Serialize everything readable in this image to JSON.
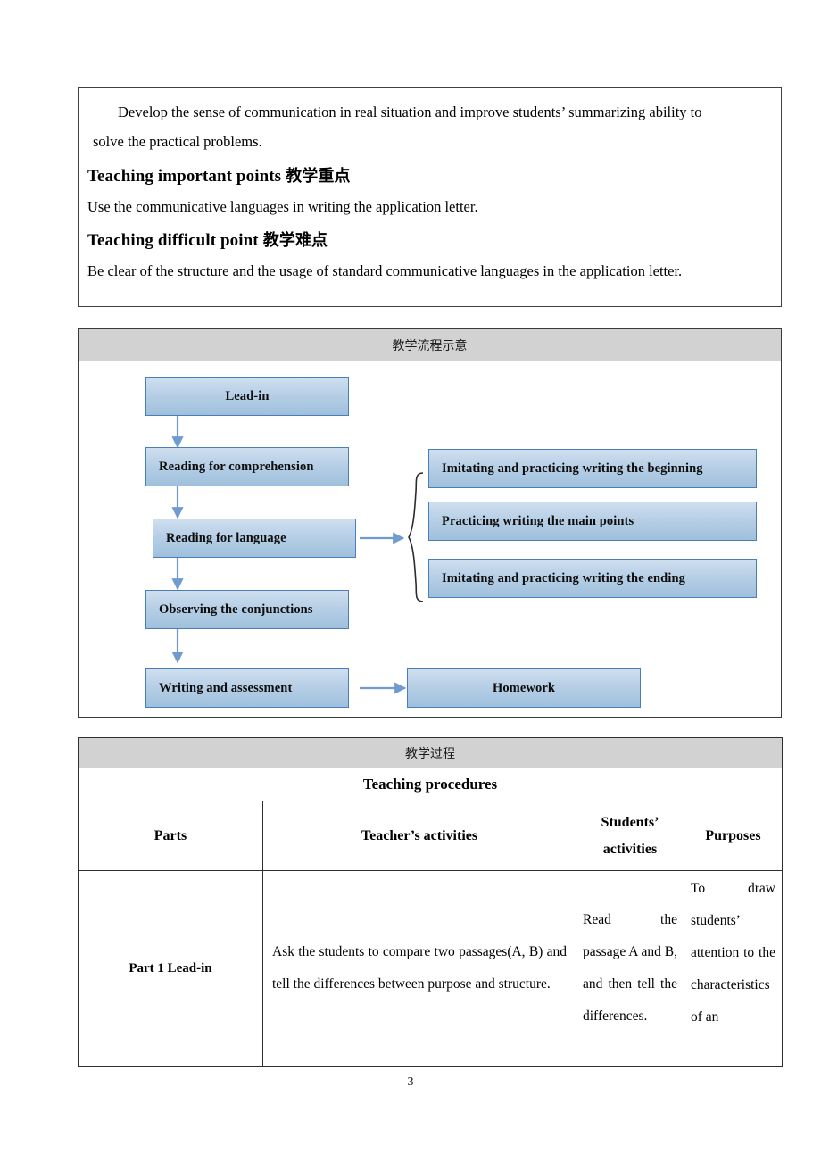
{
  "document": {
    "page_number": "3"
  },
  "objectives_box": {
    "paragraph_line1": "Develop the sense of communication in real situation and improve students’ summarizing ability to",
    "paragraph_line2": "solve the practical problems.",
    "important_points_heading_en": "Teaching important points",
    "important_points_heading_cn": "教学重点",
    "important_points_text": "Use the communicative languages in writing the application letter.",
    "difficult_point_heading_en": "Teaching difficult point",
    "difficult_point_heading_cn": "教学难点",
    "difficult_point_text": "Be clear of the structure and the usage of standard communicative languages in the application letter."
  },
  "flowchart": {
    "header_title": "教学流程示意",
    "left_column": [
      {
        "id": "lead-in",
        "label": "Lead-in"
      },
      {
        "id": "reading-for-comprehension",
        "label": "Reading for comprehension"
      },
      {
        "id": "reading-for-language",
        "label": "Reading for language"
      },
      {
        "id": "observing-the-conjunctions",
        "label": "Observing the conjunctions"
      },
      {
        "id": "writing-and-assessment",
        "label": "Writing and assessment"
      }
    ],
    "right_column": [
      {
        "id": "imitating-beginning",
        "label": "Imitating and practicing writing the beginning"
      },
      {
        "id": "practicing-main-points",
        "label": "Practicing writing the main points"
      },
      {
        "id": "imitating-ending",
        "label": "Imitating and practicing writing the ending"
      }
    ],
    "homework": {
      "id": "homework",
      "label": "Homework"
    },
    "colors": {
      "box_border": "#4a7ebb",
      "box_fill_top": "#cfdfef",
      "box_fill_bottom": "#9fc0dd",
      "arrow": "#6f9bd1",
      "header_band": "#d2d2d2"
    }
  },
  "procedures_table": {
    "header_cn": "教学过程",
    "header_en": "Teaching procedures",
    "columns": [
      "Parts",
      "Teacher’s activities",
      "Students’ activities",
      "Purposes"
    ],
    "column_students_line1": "Students’",
    "column_students_line2": "activities",
    "rows": [
      {
        "part": "Part 1 Lead-in",
        "teacher_activities": "Ask the students to compare two passages(A, B) and tell the differences between purpose and structure.",
        "students_activities": "Read the passage A and B, and then tell the differences.",
        "purposes": "To draw students’ attention to the characteristics of an"
      }
    ]
  }
}
